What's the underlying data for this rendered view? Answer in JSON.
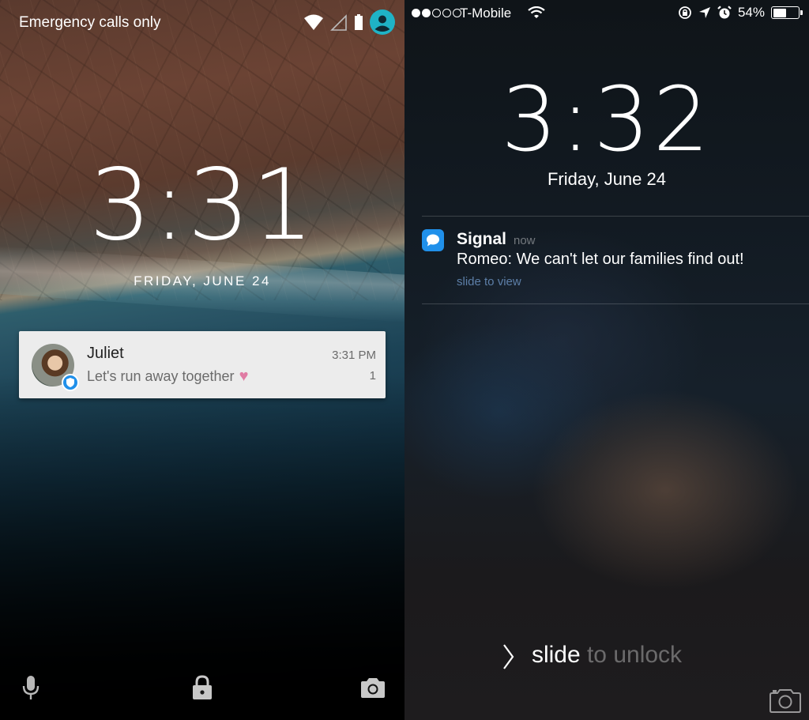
{
  "android": {
    "status_text": "Emergency calls only",
    "clock": "3:31",
    "date": "FRIDAY, JUNE 24",
    "notification": {
      "title": "Juliet",
      "message": "Let's run away together",
      "emoji": "♥",
      "time": "3:31 PM",
      "count": "1"
    },
    "icons": {
      "wifi": "wifi-icon",
      "signal": "signal-icon",
      "battery": "battery-icon",
      "user": "user-icon",
      "mic": "mic-icon",
      "lock": "lock-icon",
      "camera": "camera-icon"
    }
  },
  "ios": {
    "carrier": "T-Mobile",
    "battery_percent": "54%",
    "battery_level": 0.54,
    "clock": "3:32",
    "date": "Friday, June 24",
    "notification": {
      "app": "Signal",
      "time": "now",
      "message": "Romeo: We can't let our families find out!",
      "action": "slide to view"
    },
    "unlock": {
      "bright": "slide",
      "dim": " to unlock"
    },
    "icons": {
      "wifi": "wifi-icon",
      "rotation_lock": "rotation-lock-icon",
      "location": "location-arrow-icon",
      "alarm": "alarm-icon",
      "battery": "battery-icon",
      "camera": "camera-icon",
      "signal_app": "signal-app-icon"
    }
  },
  "colors": {
    "signal_blue": "#2090ea",
    "heart_pink": "#e07ca4",
    "slide_to_view": "#5d7fa8"
  }
}
